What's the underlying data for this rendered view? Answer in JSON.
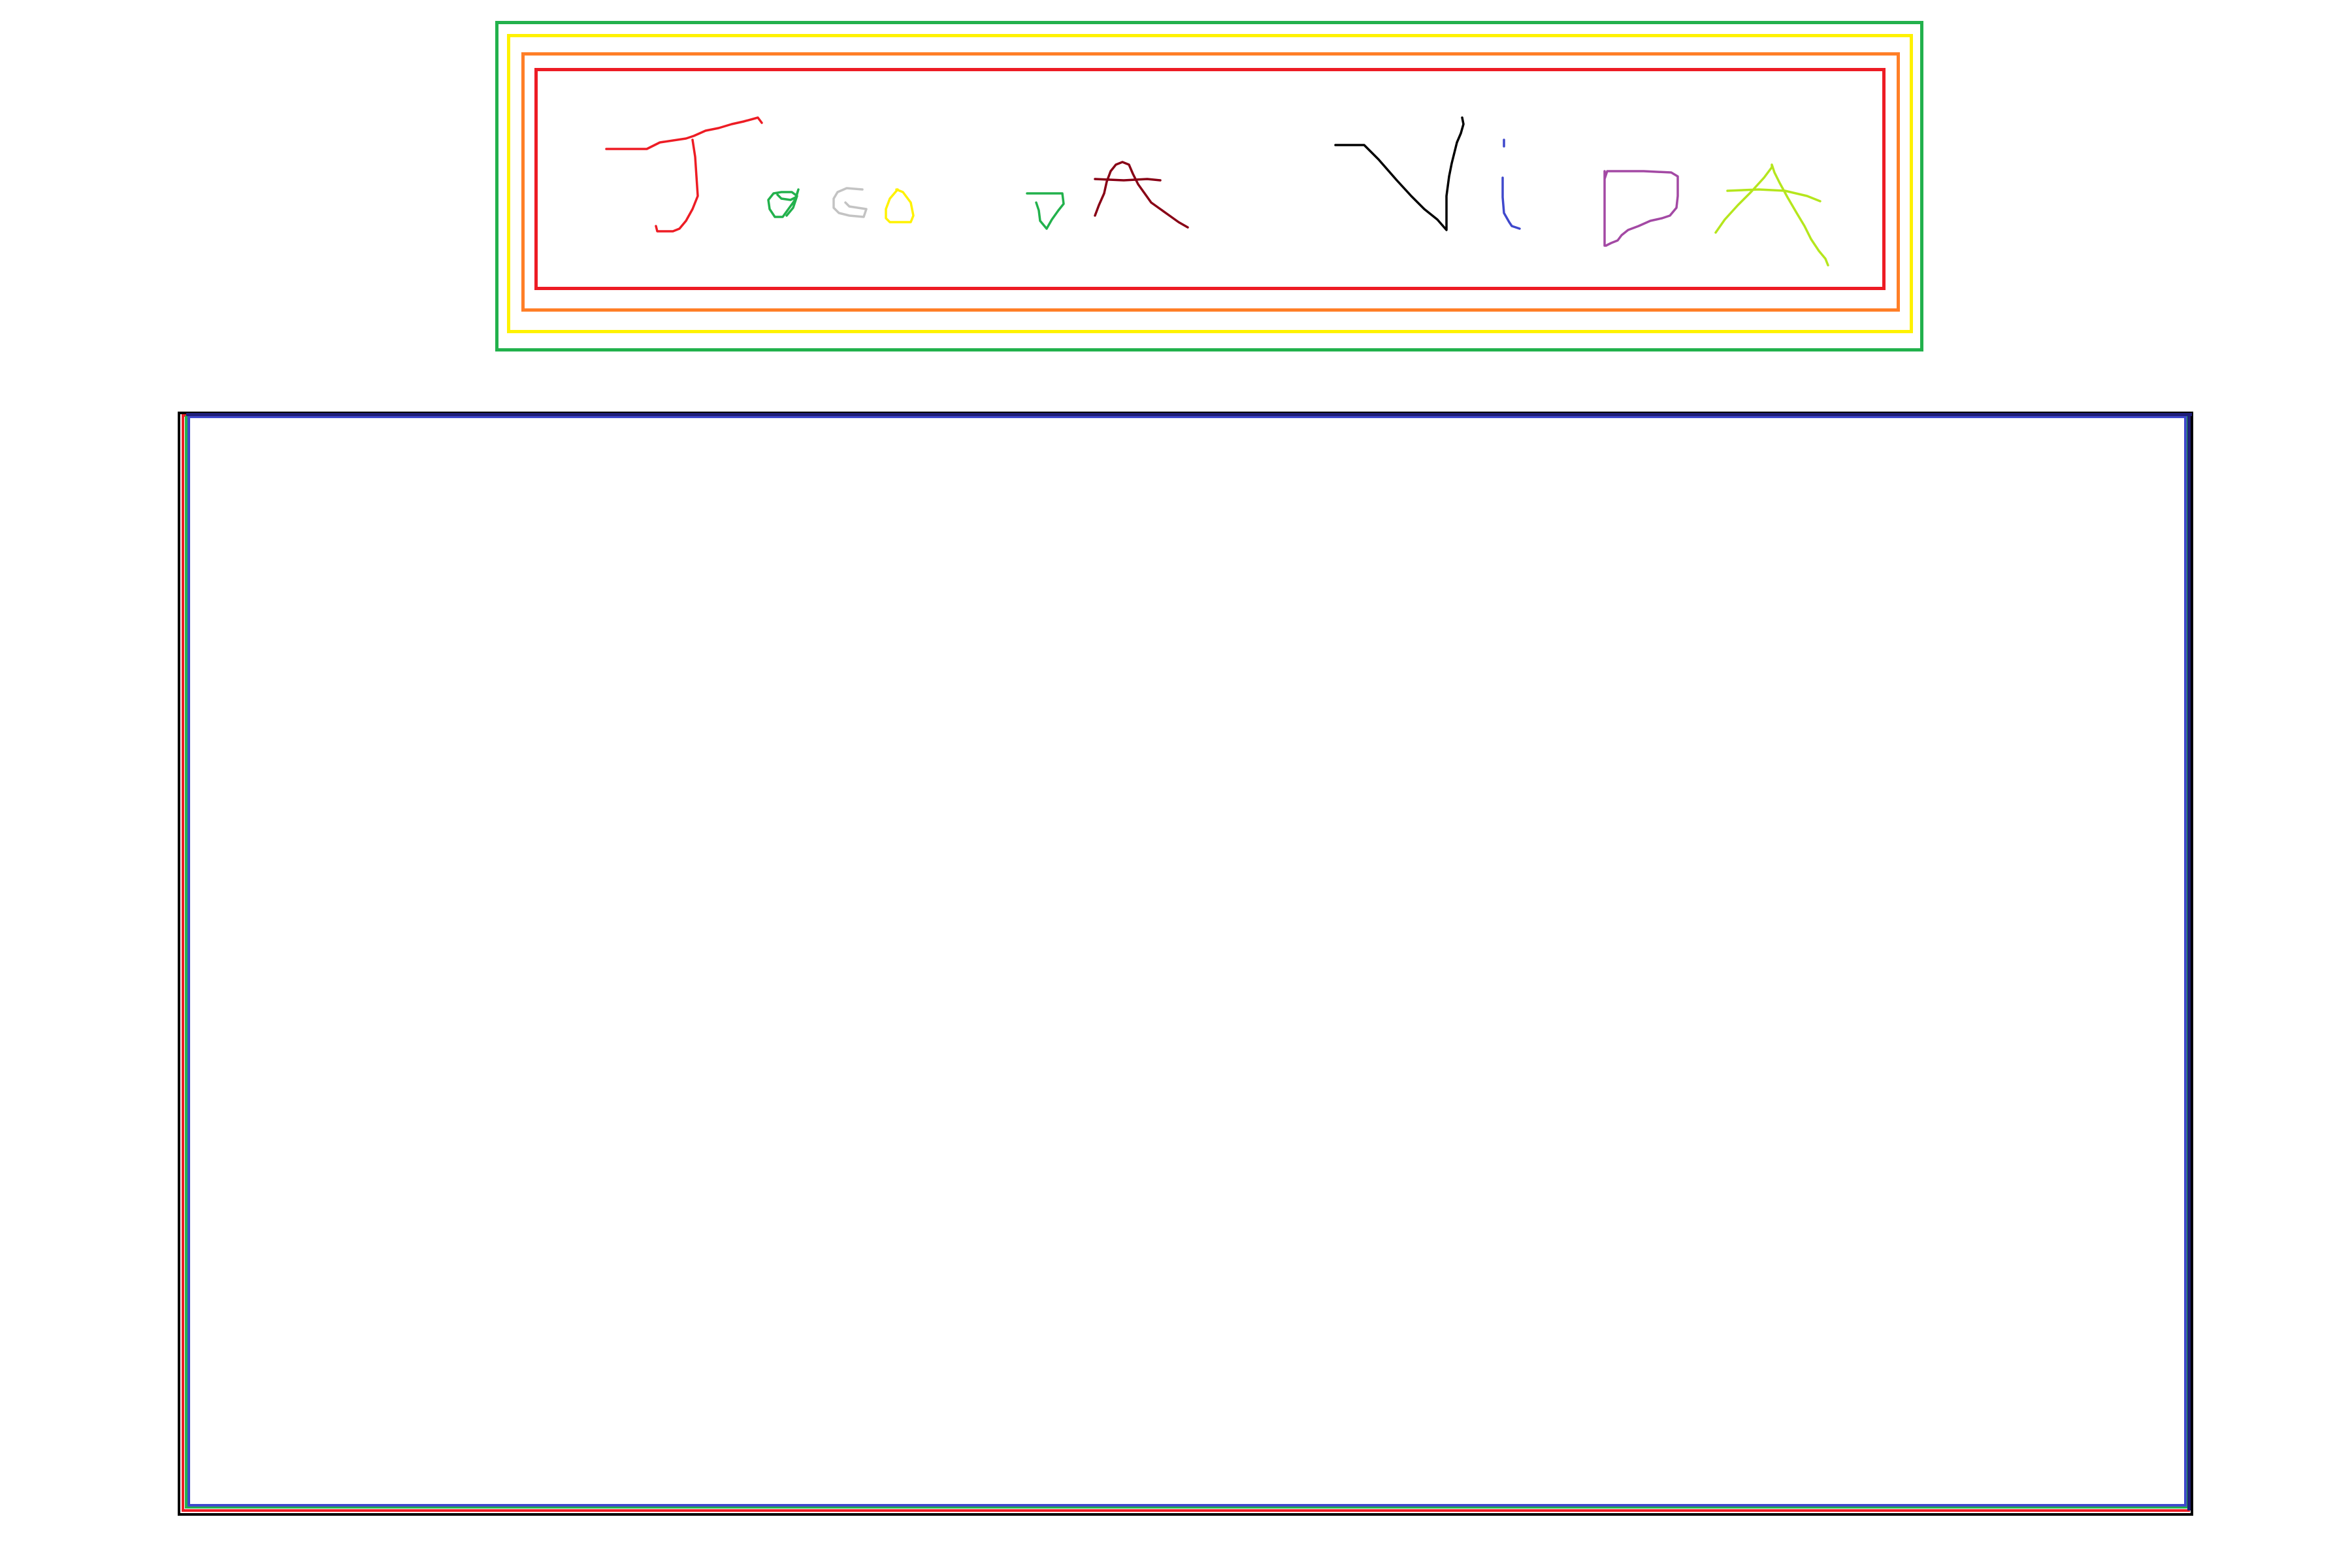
{
  "title": {
    "text": "Jogo da Vida",
    "style": "hand-drawn multicolor letters",
    "frame_colors": [
      "#22b14c",
      "#fff200",
      "#ff7f27",
      "#ed1c24"
    ],
    "letter_colors": {
      "J": "#ed1c24",
      "o1": "#22b14c",
      "g": "#c3c3c3",
      "o2": "#fff200",
      "d": "#22b14c",
      "a1": "#880015",
      "V": "#000000",
      "i": "#3f48cc",
      "D": "#a349a4",
      "A": "#b5e61d"
    }
  },
  "board": {
    "outline_colors": [
      "#000000",
      "#ed1c24",
      "#22b14c",
      "#3f48cc",
      "#1f1f7a"
    ],
    "background": "#ffffff",
    "cells_visible": 0
  }
}
